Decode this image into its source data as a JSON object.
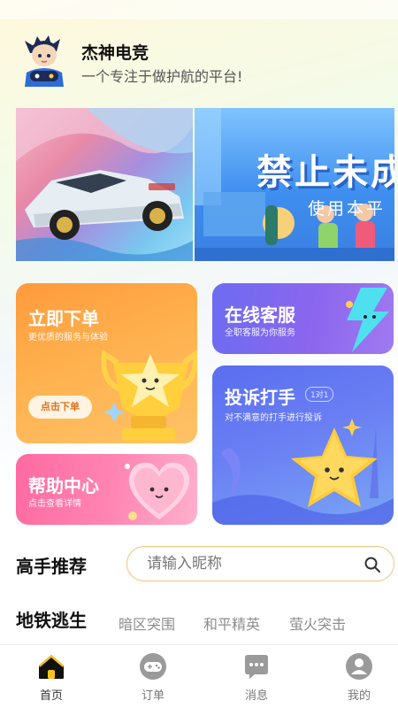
{
  "header": {
    "title": "杰神电竞",
    "subtitle": "一个专注于做护航的平台!"
  },
  "banner": {
    "title": "禁止未成",
    "subtitle": "使用本平"
  },
  "cards": {
    "order": {
      "title": "立即下单",
      "desc": "更优质的服务与体验",
      "button": "点击下单"
    },
    "service": {
      "title": "在线客服",
      "desc": "全职客服为你服务"
    },
    "complain": {
      "title": "投诉打手",
      "tag": "1对1",
      "desc": "对不满意的打手进行投诉"
    },
    "help": {
      "title": "帮助中心",
      "desc": "点击查看详情"
    }
  },
  "recommend": {
    "title": "高手推荐",
    "search_placeholder": "请输入昵称"
  },
  "categories": {
    "active": "地铁逃生",
    "items": [
      "暗区突围",
      "和平精英",
      "萤火突击"
    ]
  },
  "nav": {
    "items": [
      {
        "label": "首页",
        "icon": "home-icon",
        "active": true
      },
      {
        "label": "订单",
        "icon": "gamepad-icon",
        "active": false
      },
      {
        "label": "消息",
        "icon": "message-icon",
        "active": false
      },
      {
        "label": "我的",
        "icon": "user-icon",
        "active": false
      }
    ]
  },
  "colors": {
    "accent_orange": "#ff9a3c",
    "accent_purple": "#7a6cf0",
    "accent_blue": "#5a6ef0",
    "accent_pink": "#ff6aa1",
    "search_border": "#f3c27a"
  }
}
